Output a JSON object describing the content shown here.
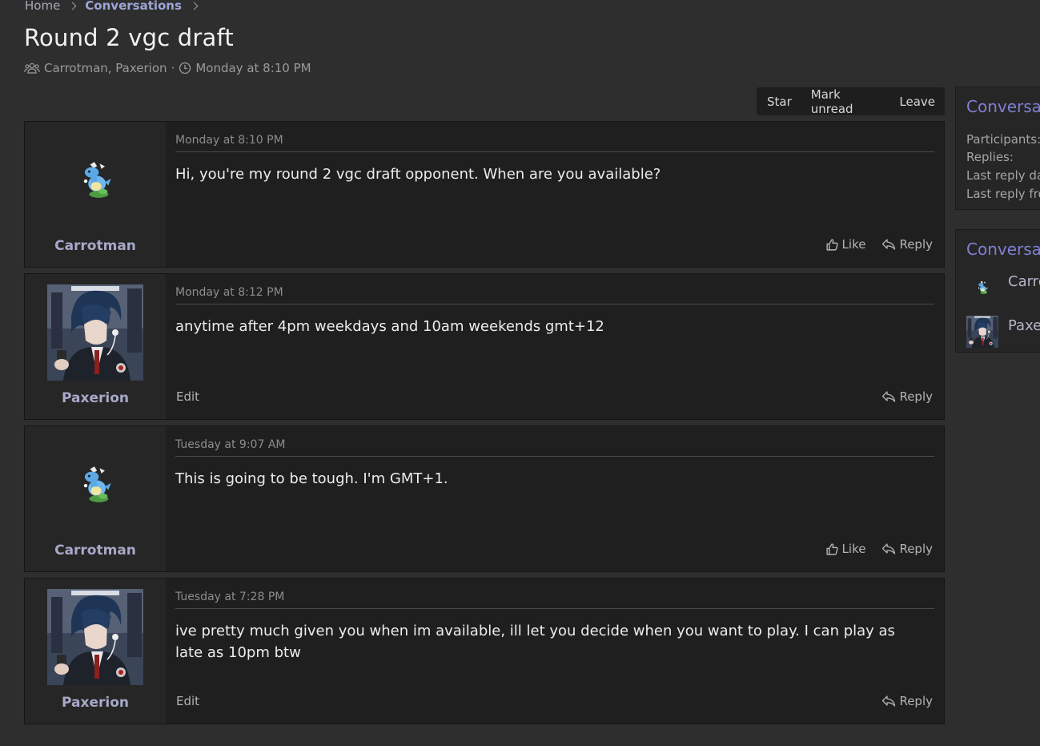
{
  "breadcrumb": {
    "home": "Home",
    "conversations": "Conversations"
  },
  "title": "Round 2 vgc draft",
  "meta": {
    "participants": "Carrotman, Paxerion",
    "separator": "·",
    "date": "Monday at 8:10 PM"
  },
  "actions": {
    "star": "Star",
    "mark_unread": "Mark unread",
    "leave": "Leave"
  },
  "messages": [
    {
      "user": "Carrotman",
      "avatar": "dragon-sprite",
      "date": "Monday at 8:10 PM",
      "body": "Hi, you're my round 2 vgc draft opponent. When are you available?",
      "like": "Like",
      "reply": "Reply"
    },
    {
      "user": "Paxerion",
      "avatar": "anime-portrait",
      "date": "Monday at 8:12 PM",
      "body": "anytime after 4pm weekdays and 10am weekends gmt+12",
      "edit": "Edit",
      "reply": "Reply"
    },
    {
      "user": "Carrotman",
      "avatar": "dragon-sprite",
      "date": "Tuesday at 9:07 AM",
      "body": "This is going to be tough. I'm GMT+1.",
      "like": "Like",
      "reply": "Reply"
    },
    {
      "user": "Paxerion",
      "avatar": "anime-portrait",
      "date": "Tuesday at 7:28 PM",
      "body": "ive pretty much given you when im available, ill let you decide when you want to play. I can play as late as 10pm btw",
      "edit": "Edit",
      "reply": "Reply"
    }
  ],
  "sidebar": {
    "info_title": "Conversation summary",
    "participants_label": "Participants:",
    "replies_label": "Replies:",
    "last_reply_date_label": "Last reply date:",
    "last_reply_from_label": "Last reply from:",
    "participants_title": "Conversation participants",
    "participants": [
      "Carrotman",
      "Paxerion"
    ]
  },
  "colors": {
    "accent": "#7f7fd6",
    "background": "#2e2e2e",
    "card": "#1f1f1f",
    "username": "#a7a9c8"
  }
}
